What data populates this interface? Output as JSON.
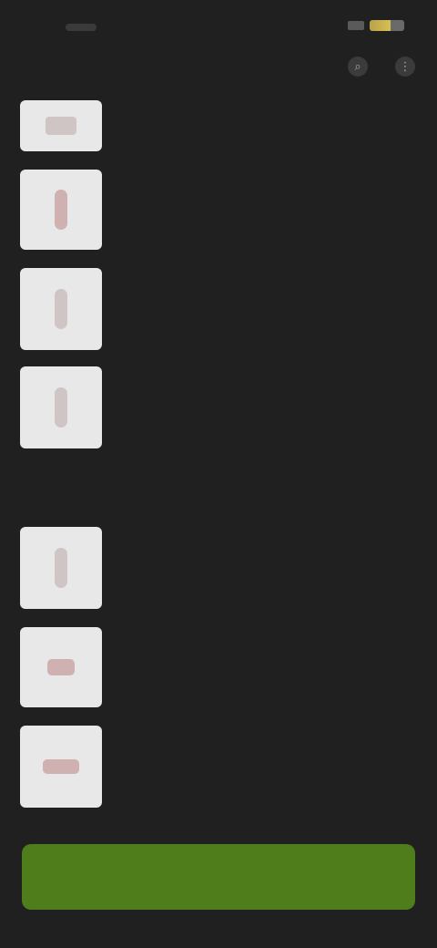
{
  "status": {
    "time": ""
  },
  "toolbar": {
    "icon1": "search-icon",
    "icon2": "more-icon"
  },
  "sections": [
    {
      "label": ""
    }
  ],
  "items_top": [
    {
      "title": ""
    },
    {
      "title": ""
    },
    {
      "title": ""
    },
    {
      "title": ""
    }
  ],
  "group": {
    "label": "",
    "link": ""
  },
  "items_bottom": [
    {
      "title": ""
    },
    {
      "title": ""
    },
    {
      "title": ""
    }
  ],
  "footer": {
    "button_label": ""
  },
  "colors": {
    "accent": "#4f7d1b",
    "background": "#202020"
  }
}
